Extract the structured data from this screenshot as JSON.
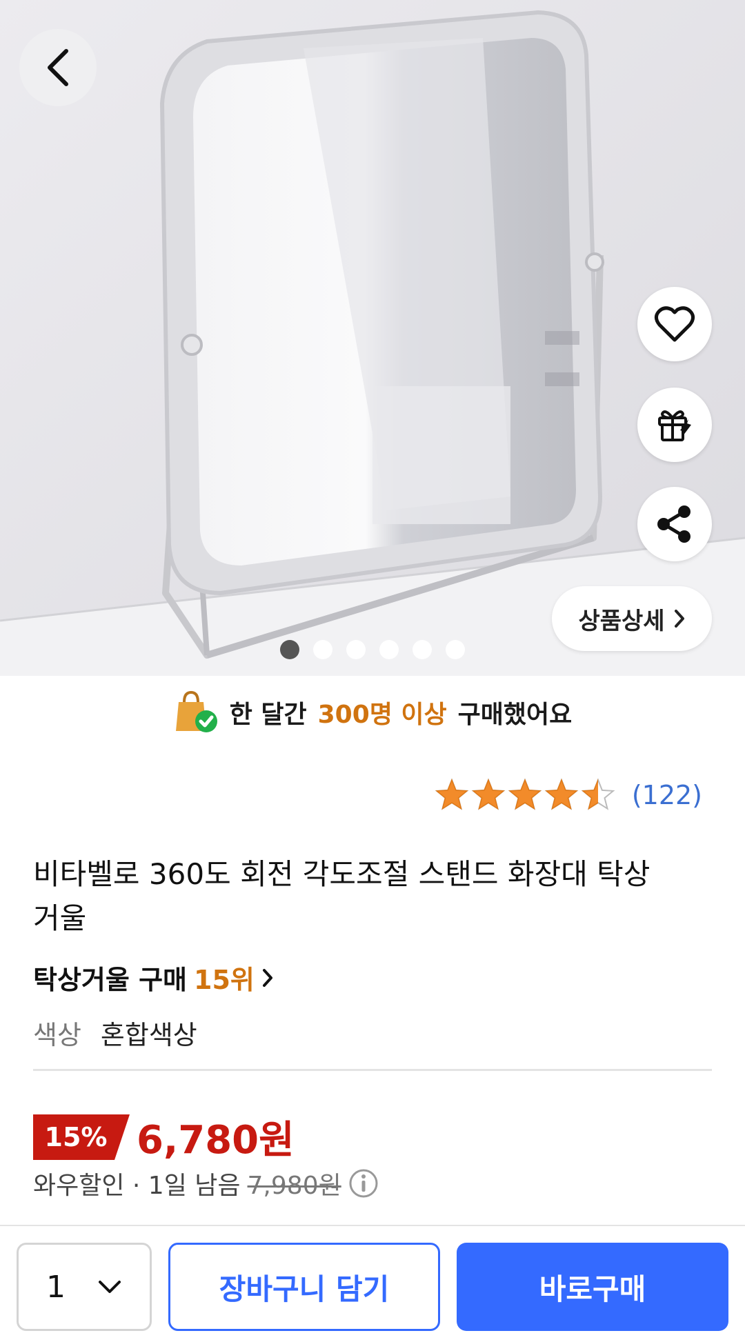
{
  "hero": {
    "image_alt": "탁상거울 제품 이미지",
    "carousel_total": 6,
    "carousel_active_index": 0,
    "detail_label": "상품상세"
  },
  "buy_banner": {
    "prefix": "한 달간",
    "highlight": "300명 이상",
    "suffix": "구매했어요"
  },
  "rating": {
    "stars": 4.5,
    "count": "(122)"
  },
  "product": {
    "title": "비타벨로 360도 회전 각도조절 스탠드 화장대 탁상거울",
    "rank_prefix": "탁상거울 구매",
    "rank_value": "15위",
    "color_label": "색상",
    "color_value": "혼합색상"
  },
  "price": {
    "discount": "15%",
    "sale_price": "6,780원",
    "promo": "와우할인 · 1일 남음",
    "original_price": "7,980원"
  },
  "bottom_bar": {
    "quantity": "1",
    "cart_label": "장바구니 담기",
    "buy_label": "바로구매"
  },
  "colors": {
    "accent_blue": "#346aff",
    "price_red": "#c71a11",
    "highlight_orange": "#d0730f",
    "star_orange": "#f28b2a"
  },
  "icons": [
    "back-arrow-icon",
    "heart-icon",
    "gift-icon",
    "share-icon",
    "chevron-right-icon",
    "shopping-bag-check-icon",
    "star-icon",
    "info-icon",
    "chevron-down-icon"
  ]
}
